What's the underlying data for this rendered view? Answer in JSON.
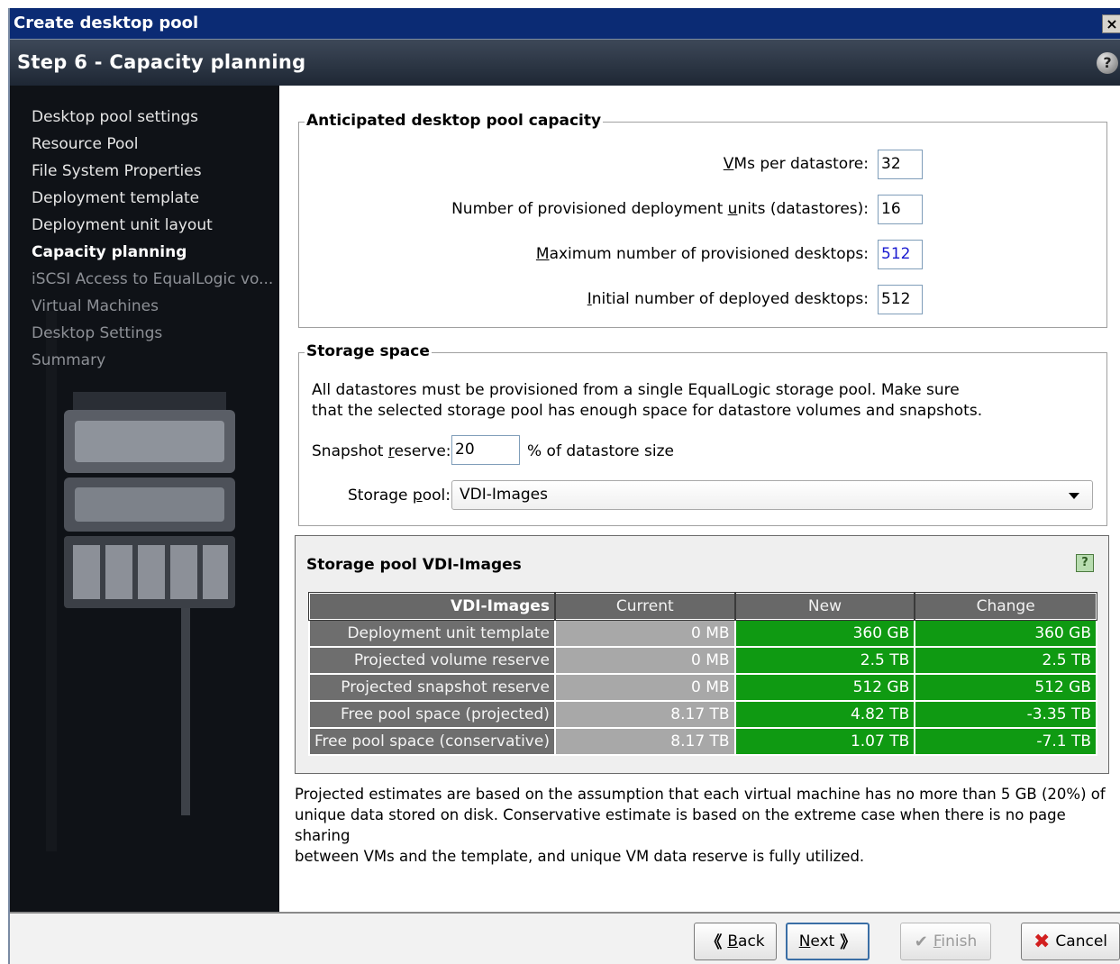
{
  "window": {
    "title": "Create desktop pool",
    "close_glyph": "×"
  },
  "step": {
    "title": "Step 6 - Capacity planning",
    "help_glyph": "?"
  },
  "sidebar": {
    "items": [
      {
        "label": "Desktop pool settings",
        "state": "done"
      },
      {
        "label": "Resource Pool",
        "state": "done"
      },
      {
        "label": "File System Properties",
        "state": "done"
      },
      {
        "label": "Deployment template",
        "state": "done"
      },
      {
        "label": "Deployment unit layout",
        "state": "done"
      },
      {
        "label": "Capacity planning",
        "state": "current"
      },
      {
        "label": "iSCSI Access to EqualLogic vo...",
        "state": "future"
      },
      {
        "label": "Virtual Machines",
        "state": "future"
      },
      {
        "label": "Desktop Settings",
        "state": "future"
      },
      {
        "label": "Summary",
        "state": "future"
      }
    ]
  },
  "capacity": {
    "legend": "Anticipated desktop pool capacity",
    "vms_per_datastore": {
      "pre": "",
      "key": "V",
      "post": "Ms per datastore:",
      "value": "32"
    },
    "units": {
      "pre": "Number of provisioned deployment ",
      "key": "u",
      "post": "nits (datastores):",
      "value": "16"
    },
    "max_desktops": {
      "pre": "",
      "key": "M",
      "post": "aximum number of provisioned desktops:",
      "value": "512"
    },
    "initial_desktops": {
      "pre": "",
      "key": "I",
      "post": "nitial number of deployed desktops:",
      "value": "512"
    }
  },
  "storage": {
    "legend": "Storage space",
    "description_line1": "All datastores must be provisioned from a single EqualLogic storage pool. Make sure",
    "description_line2": "that the selected storage pool has enough space for datastore volumes and snapshots.",
    "snapshot": {
      "pre": "Snapshot ",
      "key": "r",
      "post": "eserve:",
      "value": "20",
      "suffix": "% of datastore size"
    },
    "pool": {
      "pre": "Storage ",
      "key": "p",
      "post": "ool:",
      "value": "VDI-Images"
    }
  },
  "pool_table": {
    "title": "Storage pool VDI-Images",
    "help_glyph": "?",
    "columns": [
      "VDI-Images",
      "Current",
      "New",
      "Change"
    ],
    "rows": [
      {
        "label": "Deployment unit template",
        "current": "0 MB",
        "new": "360 GB",
        "change": "360 GB"
      },
      {
        "label": "Projected volume reserve",
        "current": "0 MB",
        "new": "2.5 TB",
        "change": "2.5 TB"
      },
      {
        "label": "Projected snapshot reserve",
        "current": "0 MB",
        "new": "512 GB",
        "change": "512 GB"
      },
      {
        "label": "Free pool space (projected)",
        "current": "8.17 TB",
        "new": "4.82 TB",
        "change": "-3.35 TB"
      },
      {
        "label": "Free pool space (conservative)",
        "current": "8.17 TB",
        "new": "1.07 TB",
        "change": "-7.1 TB"
      }
    ]
  },
  "note": {
    "line1": "Projected estimates are based on the assumption that each virtual machine has no more than 5 GB (20%) of",
    "line2": "unique data stored on disk. Conservative estimate is based on the extreme case when there is no page sharing",
    "line3": "between VMs and the template, and unique VM data reserve is fully utilized."
  },
  "buttons": {
    "back": {
      "key": "B",
      "rest": "ack",
      "glyph": "《"
    },
    "next": {
      "key": "N",
      "rest": "ext",
      "glyph": "》"
    },
    "finish": {
      "key": "F",
      "rest": "inish",
      "glyph": "✔"
    },
    "cancel": {
      "label": "Cancel",
      "glyph": "✖"
    }
  }
}
